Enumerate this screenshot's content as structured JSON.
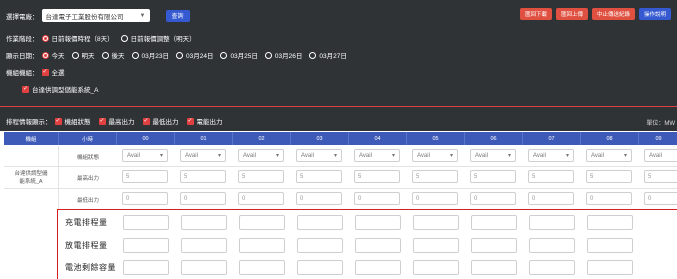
{
  "header": {
    "plant_label": "選擇電廠：",
    "plant_value": "台達電子工業股份有限公司",
    "query_button": "查詢",
    "buttons": [
      {
        "label": "匯回下載",
        "color": "#e05040"
      },
      {
        "label": "匯回上傳",
        "color": "#e05040"
      },
      {
        "label": "中止傳送紀錄",
        "color": "#e05040"
      },
      {
        "label": "操作說明",
        "color": "#3559d1"
      }
    ]
  },
  "stage": {
    "label": "作業階段：",
    "options": [
      {
        "label": "日前報價時程（8天）",
        "selected": true
      },
      {
        "label": "日前報價調整（明天）",
        "selected": false
      }
    ]
  },
  "date": {
    "label": "顯示日期：",
    "options": [
      {
        "label": "今天",
        "selected": true
      },
      {
        "label": "明天",
        "selected": false
      },
      {
        "label": "後天",
        "selected": false
      },
      {
        "label": "03月23日",
        "selected": false
      },
      {
        "label": "03月24日",
        "selected": false
      },
      {
        "label": "03月25日",
        "selected": false
      },
      {
        "label": "03月26日",
        "selected": false
      },
      {
        "label": "03月27日",
        "selected": false
      }
    ]
  },
  "units": {
    "label": "機組機組：",
    "all": "全選",
    "item": "台達供調型儲能系統_A"
  },
  "display": {
    "label": "排程情報顯示：",
    "options": [
      "機組狀態",
      "最高出力",
      "最低出力",
      "電能出力"
    ],
    "unit": "單位：MW"
  },
  "table": {
    "columns": [
      "機組",
      "小時",
      "00",
      "01",
      "02",
      "03",
      "04",
      "05",
      "06",
      "07",
      "08",
      "09"
    ],
    "unit_name": "台達供調型儲能系統_A",
    "rows": [
      {
        "label": "機組狀態",
        "cells": [
          "Avail",
          "Avail",
          "Avail",
          "Avail",
          "Avail",
          "Avail",
          "Avail",
          "Avail",
          "Avail",
          "Avail"
        ]
      },
      {
        "label": "最高出力",
        "cells": [
          "5",
          "5",
          "5",
          "5",
          "5",
          "5",
          "5",
          "5",
          "5",
          "5"
        ]
      },
      {
        "label": "最低出力",
        "cells": [
          "0",
          "0",
          "0",
          "0",
          "0",
          "0",
          "0",
          "0",
          "0",
          "0"
        ]
      }
    ]
  },
  "highlight": {
    "rows": [
      "充電排程量",
      "放電排程量",
      "電池剩餘容量"
    ]
  }
}
